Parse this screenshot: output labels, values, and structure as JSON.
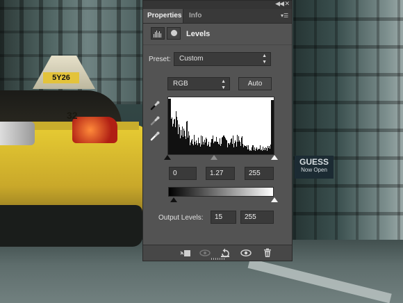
{
  "panel": {
    "tabs": [
      {
        "label": "Properties",
        "active": true
      },
      {
        "label": "Info",
        "active": false
      }
    ],
    "title": "Levels",
    "preset": {
      "label": "Preset:",
      "value": "Custom"
    },
    "channel": {
      "value": "RGB"
    },
    "auto_label": "Auto",
    "input_levels": {
      "black": "0",
      "gamma": "1.27",
      "white": "255"
    },
    "output_levels": {
      "label": "Output Levels:",
      "black": "15",
      "white": "255"
    }
  },
  "background": {
    "taxi_plate": "5Y26",
    "taxi_number": "32",
    "sign_title": "GUESS",
    "sign_subtitle": "Now Open"
  },
  "colors": {
    "panel_bg": "#535353",
    "tab_bar_bg": "#393939",
    "field_bg": "#3a3a3a",
    "taxi_yellow": "#e7cc33"
  },
  "icons": [
    "levels-histogram-icon",
    "mask-icon",
    "black-point-eyedropper-icon",
    "gray-point-eyedropper-icon",
    "white-point-eyedropper-icon",
    "clip-to-layer-icon",
    "view-previous-state-icon",
    "reset-icon",
    "visibility-eye-icon",
    "trash-icon",
    "panel-menu-icon",
    "collapse-icon",
    "close-icon"
  ]
}
